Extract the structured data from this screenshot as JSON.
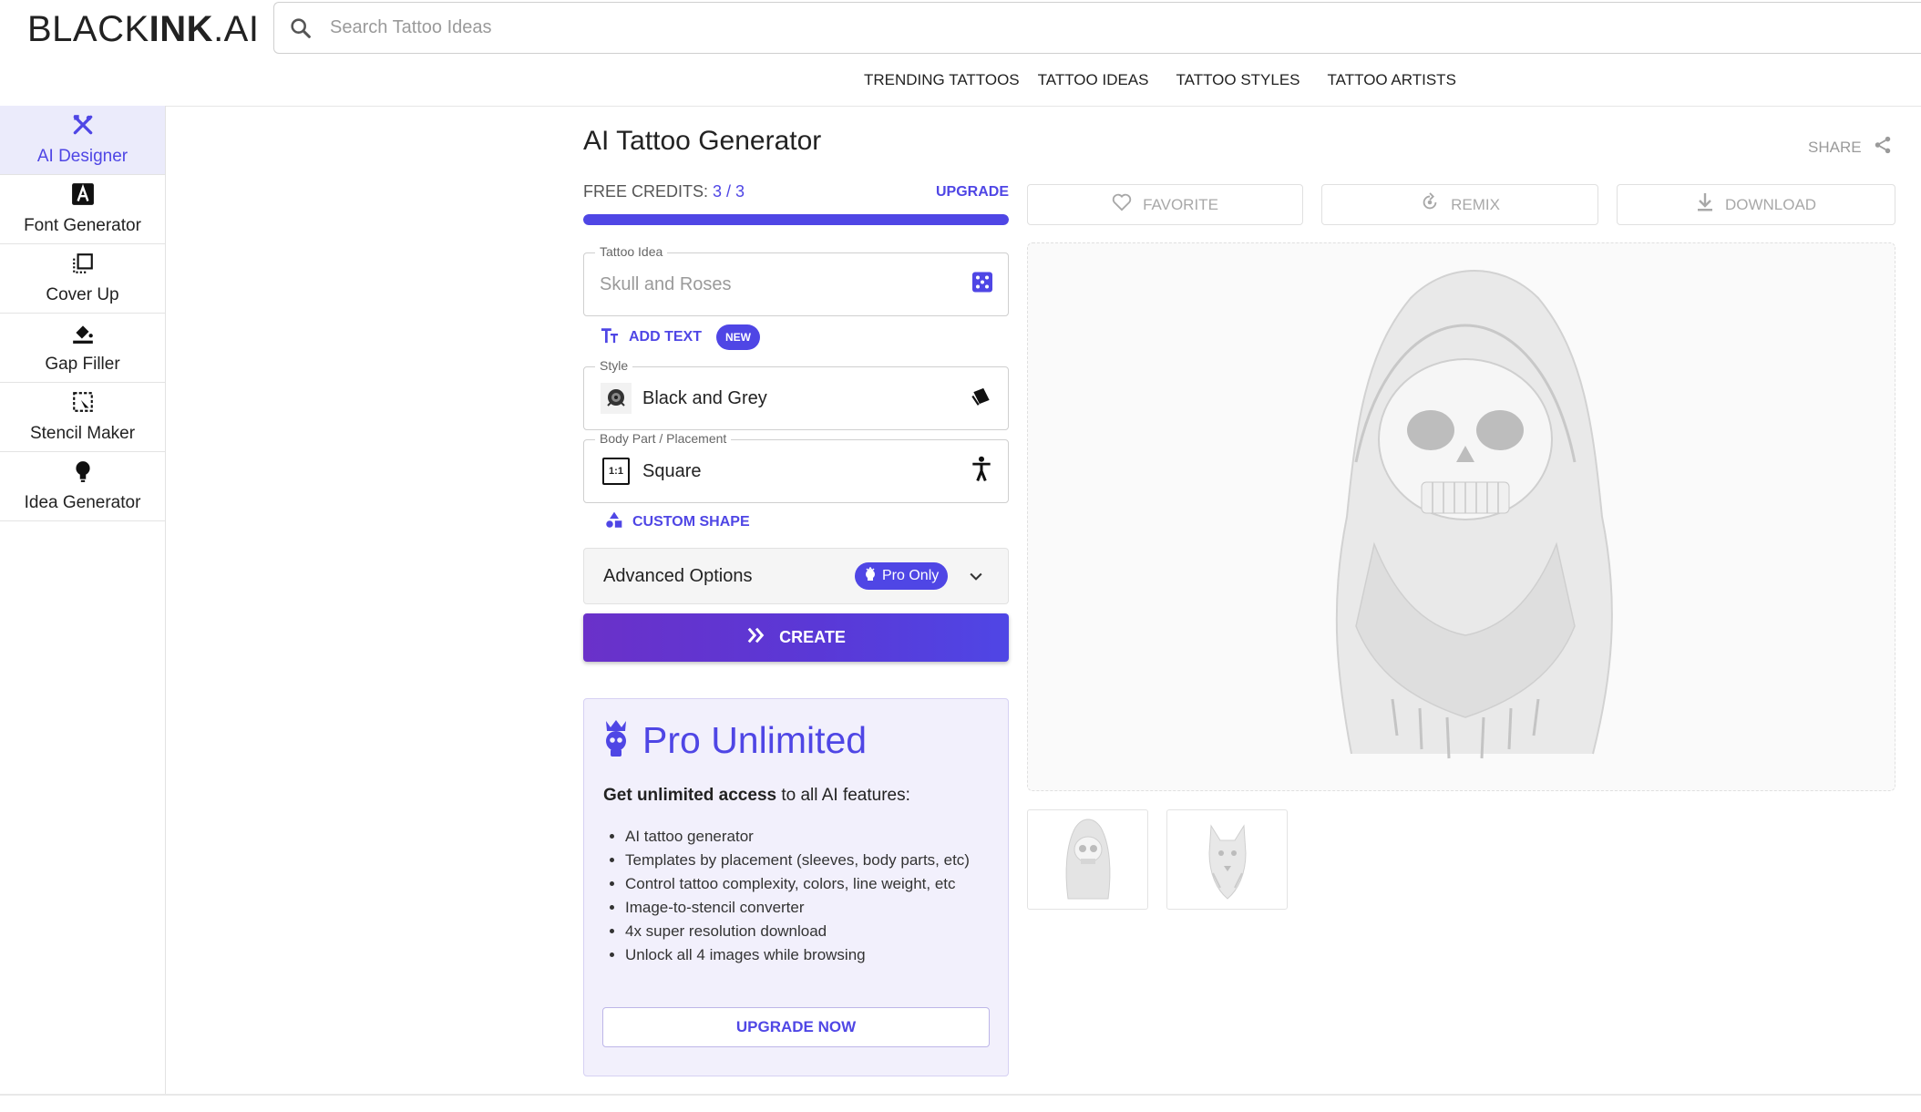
{
  "header": {
    "logo_thin": "BLACK",
    "logo_bold": "INK",
    "logo_tail": ".AI",
    "search_placeholder": "Search Tattoo Ideas",
    "nav": [
      "TRENDING TATTOOS",
      "TATTOO IDEAS",
      "TATTOO STYLES",
      "TATTOO ARTISTS"
    ]
  },
  "sidebar": {
    "items": [
      {
        "label": "AI Designer",
        "icon": "ai-designer-icon",
        "active": true
      },
      {
        "label": "Font Generator",
        "icon": "font-icon"
      },
      {
        "label": "Cover Up",
        "icon": "cover-up-icon"
      },
      {
        "label": "Gap Filler",
        "icon": "paint-bucket-icon"
      },
      {
        "label": "Stencil Maker",
        "icon": "stencil-icon"
      },
      {
        "label": "Idea Generator",
        "icon": "lightbulb-icon"
      }
    ]
  },
  "main": {
    "title": "AI Tattoo Generator",
    "share_label": "SHARE",
    "credits_label": "FREE CREDITS:",
    "credits_value": "3 / 3",
    "credits_fraction": 1.0,
    "upgrade_label": "UPGRADE",
    "tattoo_idea": {
      "legend": "Tattoo Idea",
      "placeholder": "Skull and Roses"
    },
    "add_text_label": "ADD TEXT",
    "new_badge": "NEW",
    "style": {
      "legend": "Style",
      "value": "Black and Grey"
    },
    "placement": {
      "legend": "Body Part / Placement",
      "value": "Square",
      "icon_text": "1:1"
    },
    "custom_shape_label": "CUSTOM SHAPE",
    "advanced_label": "Advanced Options",
    "pro_only_label": "Pro Only",
    "create_label": "CREATE"
  },
  "pro_card": {
    "title": "Pro Unlimited",
    "sub_bold": "Get unlimited access",
    "sub_rest": " to all AI features:",
    "features": [
      "AI tattoo generator",
      "Templates by placement (sleeves, body parts, etc)",
      "Control tattoo complexity, colors, line weight, etc",
      "Image-to-stencil converter",
      "4x super resolution download",
      "Unlock all 4 images while browsing"
    ],
    "cta": "UPGRADE NOW"
  },
  "actions": {
    "favorite": "FAVORITE",
    "remix": "REMIX",
    "download": "DOWNLOAD"
  },
  "colors": {
    "accent": "#4f46e5",
    "active_bg": "#ebebfb",
    "card_bg": "#f2f0fc"
  }
}
